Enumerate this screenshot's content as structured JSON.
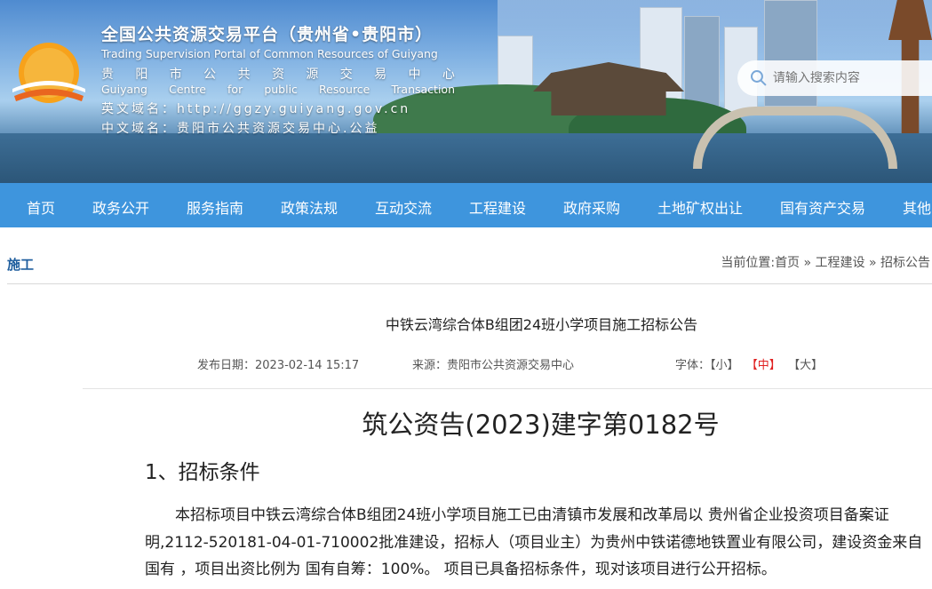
{
  "header": {
    "title_cn": "全国公共资源交易平台（贵州省•贵阳市）",
    "title_en": "Trading Supervision Portal of Common Resources of Guiyang",
    "center_cn_chars": [
      "贵",
      "阳",
      "市",
      "公",
      "共",
      "资",
      "源",
      "交",
      "易",
      "中",
      "心"
    ],
    "center_en_words": [
      "Guiyang",
      "Centre",
      "for",
      "public",
      "Resource",
      "Transaction"
    ],
    "domain_en_label": "英文域名：",
    "domain_en_value": "http://ggzy.guiyang.gov.cn",
    "domain_cn_label": "中文域名：",
    "domain_cn_value": "贵阳市公共资源交易中心.公益",
    "search_placeholder": "请输入搜索内容",
    "logo_icon": "sunrise-logo-icon"
  },
  "nav": {
    "items": [
      "首页",
      "政务公开",
      "服务指南",
      "政策法规",
      "互动交流",
      "工程建设",
      "政府采购",
      "土地矿权出让",
      "国有资产交易",
      "其他"
    ]
  },
  "section": {
    "title": "施工",
    "breadcrumb_prefix": "当前位置:",
    "breadcrumb": [
      "首页",
      "工程建设",
      "招标公告"
    ],
    "breadcrumb_sep": " » "
  },
  "article": {
    "title": "中铁云湾综合体B组团24班小学项目施工招标公告",
    "publish_date_label": "发布日期：",
    "publish_date": "2023-02-14 15:17",
    "source_label": "来源：",
    "source": "贵阳市公共资源交易中心",
    "font_label": "字体：",
    "font_small": "【小】",
    "font_medium": "【中】",
    "font_large": "【大】",
    "doc_number": "筑公资告(2023)建字第0182号",
    "heading_1": "1、招标条件",
    "paragraph_1": "本招标项目中铁云湾综合体B组团24班小学项目施工已由清镇市发展和改革局以 贵州省企业投资项目备案证明,2112-520181-04-01-710002批准建设，招标人（项目业主）为贵州中铁诺德地铁置业有限公司，建设资金来自 国有 ，项目出资比例为 国有自筹：100%。 项目已具备招标条件，现对该项目进行公开招标。"
  },
  "colors": {
    "nav_bg": "#3e95dd",
    "section_title": "#1f5e9e",
    "font_active": "#e02020"
  }
}
